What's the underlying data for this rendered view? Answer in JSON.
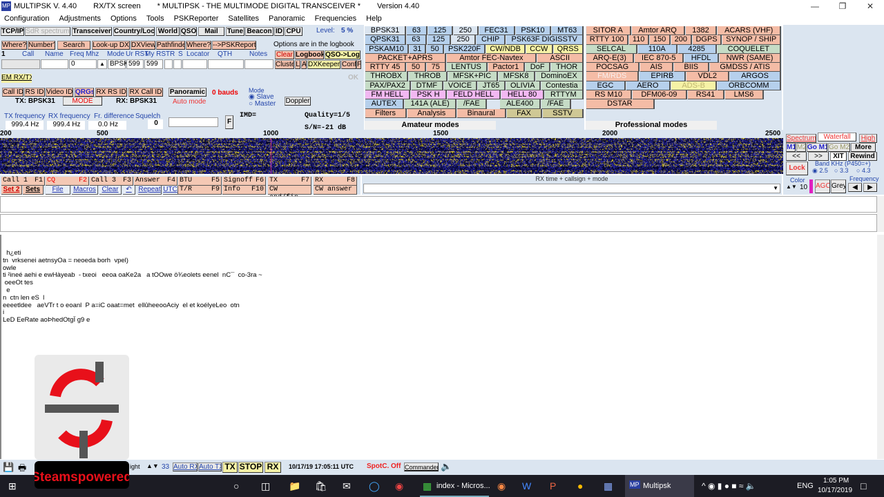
{
  "window": {
    "app": "MULTIPSK V. 4.40",
    "screen": "RX/TX screen",
    "subtitle": "* MULTIPSK - THE MULTIMODE DIGITAL TRANSCEIVER *",
    "version": "Version 4.40",
    "icon_label": "MP"
  },
  "menu": [
    "Configuration",
    "Adjustments",
    "Options",
    "Tools",
    "PSKReporter",
    "Satellites",
    "Panoramic",
    "Frequencies",
    "Help"
  ],
  "toolbar": {
    "tabs": [
      "TCP/IP",
      "SdR spectrum",
      "Transceiver",
      "Country/Loc",
      "World",
      "QSO",
      "Mail",
      "Tune",
      "Beacon",
      "ID",
      "CPU"
    ],
    "level_label": "Level:",
    "level_value": "5 %"
  },
  "log": {
    "buttons": [
      "Where?",
      "Number?",
      "Search",
      "Look-up DXK",
      "DXView",
      "Pathfinder",
      "Where?",
      "-->PSKReporter"
    ],
    "options_note": "Options are in the logbook",
    "counter": "1",
    "headers": [
      "Call",
      "Name",
      "Freq Mhz",
      "Mode",
      "Ur RST",
      "My RST",
      "R",
      "S",
      "Locator",
      "QTH",
      "Notes"
    ],
    "freq": "0",
    "mode": "BPSK",
    "ur_rst": "599",
    "my_rst": "599",
    "right_buttons": [
      "Clear",
      "Logbook",
      "QSO->Log",
      "Cluster",
      "L",
      "A",
      "DXKeeper",
      "Conf",
      "F"
    ]
  },
  "em": {
    "label": "EM RX/TX",
    "ok": "OK"
  },
  "ids": {
    "buttons": [
      "Call ID",
      "RS ID",
      "Video ID",
      "QRGs",
      "RX RS ID",
      "RX Call ID"
    ],
    "tx": "TX: BPSK31",
    "mode": "MODE",
    "rx": "RX: BPSK31",
    "panoramic": "Panoramic",
    "bauds": "0 bauds",
    "auto_mode": "Auto mode",
    "mode_group": "Mode",
    "slave": "Slave",
    "master": "Master",
    "doppler": "Doppler"
  },
  "freqs": {
    "tx_label": "TX frequency",
    "tx": "999.4 Hz",
    "rx_label": "RX frequency",
    "rx": "999.4 Hz",
    "diff_label": "Fr. difference",
    "diff": "0.0 Hz",
    "squelch_label": "Squelch",
    "squelch": "0",
    "f_btn": "F",
    "imd": "IMD=",
    "quality": "Quality=1/5",
    "sn": "S/N=-21 dB"
  },
  "amateur": {
    "title": "Amateur modes",
    "rows": [
      [
        [
          "BPSK31",
          "gray"
        ],
        [
          "63",
          "blue"
        ],
        [
          "125",
          "blue"
        ],
        [
          "250",
          "gray"
        ],
        [
          "FEC31",
          "blue"
        ],
        [
          "PSK10",
          "blue"
        ],
        [
          "MT63",
          "blue"
        ]
      ],
      [
        [
          "QPSK31",
          "blue"
        ],
        [
          "63",
          "blue"
        ],
        [
          "125",
          "blue"
        ],
        [
          "250",
          "gray"
        ],
        [
          "CHIP",
          "blue"
        ],
        [
          "PSK63F DIGISSTV",
          "blue"
        ]
      ],
      [
        [
          "PSKAM10",
          "blue"
        ],
        [
          "31",
          "blue"
        ],
        [
          "50",
          "blue"
        ],
        [
          "PSK220F",
          "blue"
        ],
        [
          "CW/NDB",
          "yellow"
        ],
        [
          "CCW",
          "yellow"
        ],
        [
          "QRSS",
          "yellow"
        ]
      ],
      [
        [
          "PACKET+APRS",
          "salmon"
        ],
        [
          "Amtor FEC-Navtex",
          "salmon"
        ],
        [
          "ASCII",
          "salmon"
        ]
      ],
      [
        [
          "RTTY 45",
          "salmon"
        ],
        [
          "50",
          "salmon"
        ],
        [
          "75",
          "salmon"
        ],
        [
          "LENTUS",
          "green"
        ],
        [
          "Pactor1",
          "salmon"
        ],
        [
          "DoF",
          "green"
        ],
        [
          "THOR",
          "green"
        ]
      ],
      [
        [
          "THROBX",
          "green"
        ],
        [
          "THROB",
          "green"
        ],
        [
          "MFSK+PIC",
          "green"
        ],
        [
          "MFSK8",
          "green"
        ],
        [
          "DominoEX",
          "green"
        ]
      ],
      [
        [
          "PAX/PAX2",
          "green"
        ],
        [
          "DTMF",
          "green"
        ],
        [
          "VOICE",
          "green"
        ],
        [
          "JT65",
          "green"
        ],
        [
          "OLIVIA",
          "green"
        ],
        [
          "Contestia",
          "green"
        ]
      ],
      [
        [
          "FM HELL",
          "pink"
        ],
        [
          "PSK H",
          "pink"
        ],
        [
          "FELD HELL",
          "pink"
        ],
        [
          "HELL 80",
          "pink"
        ],
        [
          "RTTYM",
          "green"
        ]
      ],
      [
        [
          "AUTEX",
          "blue"
        ],
        [
          "141A (ALE)",
          "green"
        ],
        [
          "/FAE",
          "green"
        ],
        [
          "",
          "empty"
        ],
        [
          "ALE400",
          "green"
        ],
        [
          "/FAE",
          "green"
        ],
        [
          "",
          "empty"
        ]
      ],
      [
        [
          "Filters",
          "salmon"
        ],
        [
          "Analysis",
          "salmon"
        ],
        [
          "Binaural",
          "salmon"
        ],
        [
          "FAX",
          "olive"
        ],
        [
          "SSTV",
          "olive"
        ]
      ]
    ]
  },
  "professional": {
    "title": "Professional modes",
    "rows": [
      [
        [
          "SITOR A",
          "salmon"
        ],
        [
          "Amtor ARQ",
          "salmon"
        ],
        [
          "1382",
          "salmon"
        ],
        [
          "ACARS (VHF)",
          "salmon"
        ]
      ],
      [
        [
          "RTTY 100",
          "salmon"
        ],
        [
          "110",
          "salmon"
        ],
        [
          "150",
          "salmon"
        ],
        [
          "200",
          "salmon"
        ],
        [
          "DGPS",
          "salmon"
        ],
        [
          "SYNOP / SHIP",
          "salmon"
        ]
      ],
      [
        [
          "SELCAL",
          "green"
        ],
        [
          "110A",
          "blue"
        ],
        [
          "4285",
          "blue"
        ],
        [
          "COQUELET",
          "green"
        ]
      ],
      [
        [
          "ARQ-E(3)",
          "salmon"
        ],
        [
          "IEC 870-5",
          "salmon"
        ],
        [
          "HFDL",
          "blue"
        ],
        [
          "NWR (SAME)",
          "salmon"
        ]
      ],
      [
        [
          "POCSAG",
          "salmon"
        ],
        [
          "AIS",
          "salmon"
        ],
        [
          "BIIS",
          "salmon"
        ],
        [
          "GMDSS / ATIS",
          "salmon"
        ]
      ],
      [
        [
          "FM/RDS",
          "salmon"
        ],
        [
          "EPIRB",
          "blue"
        ],
        [
          "VDL2",
          "salmon"
        ],
        [
          "ARGOS",
          "blue"
        ]
      ],
      [
        [
          "EGC",
          "blue"
        ],
        [
          "AERO",
          "blue"
        ],
        [
          "ADS-B",
          "yellow"
        ],
        [
          "ORBCOMM",
          "blue"
        ]
      ],
      [
        [
          "RS M10",
          "salmon"
        ],
        [
          "DFM06-09",
          "salmon"
        ],
        [
          "RS41",
          "salmon"
        ],
        [
          "LMS6",
          "salmon"
        ],
        [
          "",
          "empty"
        ]
      ],
      [
        [
          "DSTAR",
          "salmon"
        ],
        [
          "",
          "empty"
        ],
        [
          "",
          "empty"
        ],
        [
          "",
          "empty"
        ]
      ]
    ]
  },
  "scale": [
    "200",
    "500",
    "1000",
    "1500",
    "2000",
    "2500"
  ],
  "wf": {
    "tabs": [
      "Spectrum",
      "Waterfall",
      "High"
    ],
    "mem": [
      "M1",
      "M2",
      "Go M1",
      "Go M2",
      "More"
    ],
    "nav": [
      "<<",
      ">>",
      "XIT",
      "Rewind"
    ],
    "lock": "Lock",
    "band_label": "Band KHz (P450=+)",
    "bands": [
      "2.5",
      "3.3",
      "4.3"
    ],
    "color_label": "Color",
    "color_value": "10",
    "agc": "AGC",
    "grey": "Grey",
    "freq_label": "Frequency"
  },
  "macros": {
    "row1": [
      [
        "Call 1",
        "F1"
      ],
      [
        "CQ",
        "F2"
      ],
      [
        "Call 3",
        "F3"
      ],
      [
        "Answer",
        "F4"
      ],
      [
        "BTU",
        "F5"
      ],
      [
        "Signoff",
        "F6"
      ],
      [
        "TX",
        "F7"
      ],
      [
        "RX",
        "F8"
      ]
    ],
    "row2a": [
      "Set 2",
      "Sets",
      "File",
      "Macros",
      "Clear",
      "Repeat",
      "UTC"
    ],
    "row2b": [
      [
        "T/R",
        "F9"
      ],
      [
        "Info",
        "F10"
      ],
      [
        "CW end/fin",
        ""
      ],
      [
        "CW answer",
        ""
      ]
    ]
  },
  "rxlist": {
    "header": "RX time + callsign + mode"
  },
  "rx_text": "  h¿eti\ntn  vrksenei aetnsyOa = neoeda borh  vpel)\nowle\nti ²ineé aehi e ewHàyeab  - txeoi   eeoa oaKe2a   a tOOwe ö¾eolets eenel  nC¯  co-3ra ~\n oeeOt tes\n  e\nn  ctn len eS  l\neeeetldee   aeVTr t o eoanl  P a=iC oaat=met  ellûheeooAciy  el et koélyeLeo  otn\ni\nLeD EeRate aoÞhedOtgÏ g9 e",
  "status": {
    "light": "ight",
    "value": "33",
    "auto_rx": "Auto RX",
    "auto_tx": "Auto TX",
    "tx": "TX",
    "stop": "STOP",
    "rx": "RX",
    "datetime": "10/17/19 17:05:11 UTC",
    "spot": "SpotC. Off",
    "commander": "Commander"
  },
  "watermark": {
    "text": "Steamspowered"
  },
  "taskbar": {
    "apps": [
      "index - Micros...",
      "Multipsk"
    ],
    "lang": "ENG",
    "time": "1:05 PM",
    "date": "10/17/2019"
  },
  "colors": {
    "panel": "#dbe5f0",
    "blue": "#b6d0ec",
    "salmon": "#f4bca6",
    "green": "#c6dcc6",
    "yellow": "#f6f2a6",
    "pink": "#f2b8f2",
    "olive": "#cfc895"
  }
}
